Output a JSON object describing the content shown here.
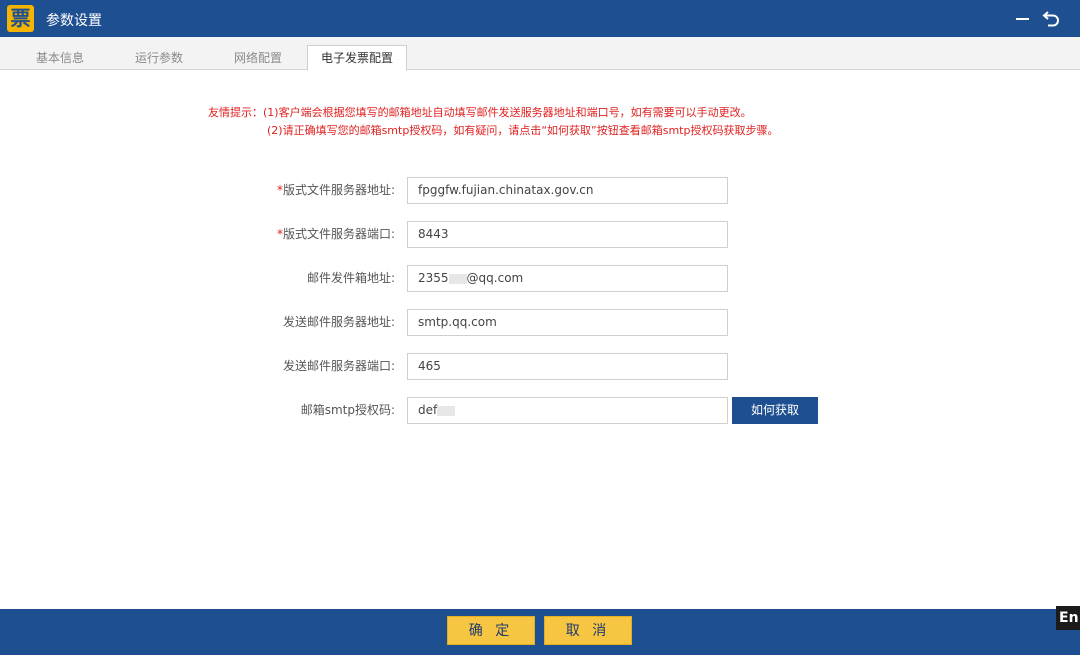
{
  "window": {
    "logo_char": "票",
    "title": "参数设置",
    "minimize_icon": "minimize-icon",
    "back_icon": "undo-arrow-icon"
  },
  "tabs": [
    {
      "label": "基本信息",
      "active": false
    },
    {
      "label": "运行参数",
      "active": false
    },
    {
      "label": "网络配置",
      "active": false
    },
    {
      "label": "电子发票配置",
      "active": true
    }
  ],
  "hint": {
    "line1": "友情提示：(1)客户端会根据您填写的邮箱地址自动填写邮件发送服务器地址和端口号，如有需要可以手动更改。",
    "line2": "(2)请正确填写您的邮箱smtp授权码，如有疑问，请点击“如何获取”按钮查看邮箱smtp授权码获取步骤。"
  },
  "form": {
    "fields": [
      {
        "required": true,
        "label": "版式文件服务器地址:",
        "value": "fpggfw.fujian.chinatax.gov.cn"
      },
      {
        "required": true,
        "label": "版式文件服务器端口:",
        "value": "8443"
      },
      {
        "required": false,
        "label": "邮件发件箱地址:",
        "value_prefix": "2355",
        "value_suffix": "@qq.com"
      },
      {
        "required": false,
        "label": "发送邮件服务器地址:",
        "value": "smtp.qq.com"
      },
      {
        "required": false,
        "label": "发送邮件服务器端口:",
        "value": "465"
      },
      {
        "required": false,
        "label": "邮箱smtp授权码:",
        "value_prefix": "def"
      }
    ],
    "required_mark": "*",
    "how_button": "如何获取"
  },
  "footer": {
    "confirm": "确 定",
    "cancel": "取 消"
  },
  "ime_indicator": "En",
  "colors": {
    "primary": "#1d4f91",
    "accent": "#f6c542",
    "warning": "#e02020"
  }
}
